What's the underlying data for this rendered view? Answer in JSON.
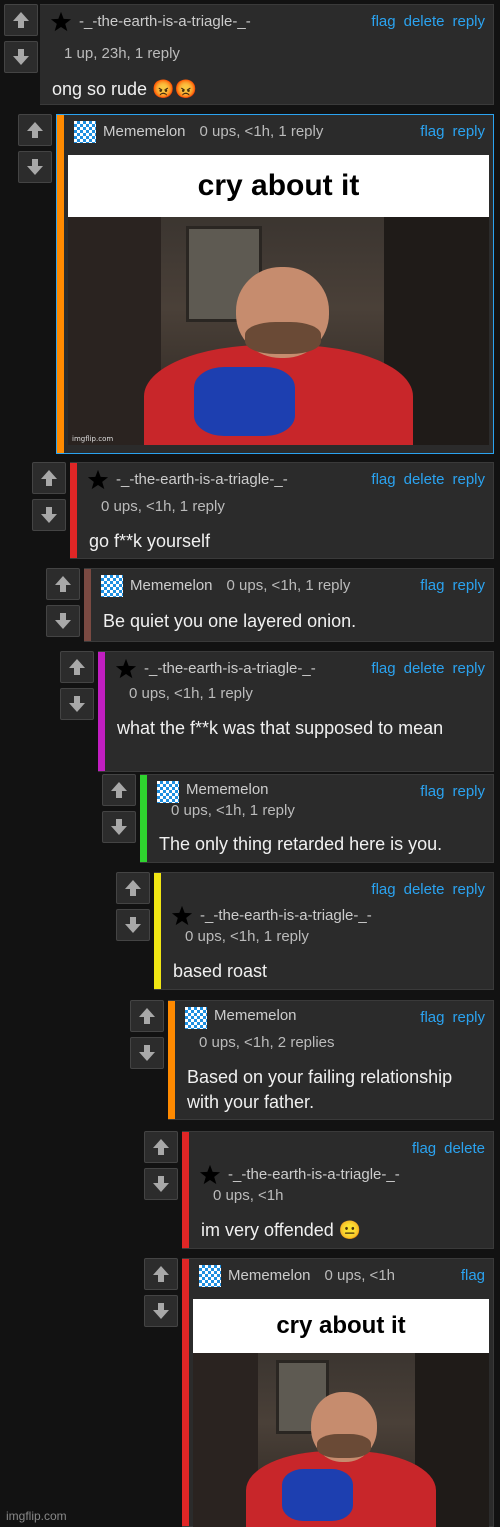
{
  "comments": [
    {
      "user": "-_-the-earth-is-a-triagle-_-",
      "meta": "1 up, 23h, 1 reply",
      "text": "ong so rude 😡😡",
      "actions": [
        "flag",
        "delete",
        "reply"
      ],
      "bar_color": "",
      "avatar": "star-icon"
    },
    {
      "user": "Mememelon",
      "meta": "0 ups, <1h, 1 reply",
      "actions": [
        "flag",
        "reply"
      ],
      "bar_color": "#ff8a00",
      "avatar": "checker-avatar",
      "image_caption": "cry about it",
      "image_watermark": "imgflip.com"
    },
    {
      "user": "-_-the-earth-is-a-triagle-_-",
      "meta": "0 ups, <1h, 1 reply",
      "text": "go f**k yourself",
      "actions": [
        "flag",
        "delete",
        "reply"
      ],
      "bar_color": "#e02626",
      "avatar": "star-icon"
    },
    {
      "user": "Mememelon",
      "meta": "0 ups, <1h, 1 reply",
      "text": "Be quiet you one layered onion.",
      "actions": [
        "flag",
        "reply"
      ],
      "bar_color": "#7a4a42",
      "avatar": "checker-avatar"
    },
    {
      "user": "-_-the-earth-is-a-triagle-_-",
      "meta": "0 ups, <1h, 1 reply",
      "text": "what the f**k was that supposed to mean",
      "actions": [
        "flag",
        "delete",
        "reply"
      ],
      "bar_color": "#c21ec2",
      "avatar": "star-icon"
    },
    {
      "user": "Mememelon",
      "meta": "0 ups, <1h, 1 reply",
      "text": "The only thing retarded here is you.",
      "actions": [
        "flag",
        "reply"
      ],
      "bar_color": "#2fd32f",
      "avatar": "checker-avatar"
    },
    {
      "user": "-_-the-earth-is-a-triagle-_-",
      "meta": "0 ups, <1h, 1 reply",
      "text": "based roast",
      "actions": [
        "flag",
        "delete",
        "reply"
      ],
      "bar_color": "#f0e614",
      "avatar": "star-icon"
    },
    {
      "user": "Mememelon",
      "meta": "0 ups, <1h, 2 replies",
      "text": "Based on your failing relationship with your father.",
      "actions": [
        "flag",
        "reply"
      ],
      "bar_color": "#ff8a00",
      "avatar": "checker-avatar"
    },
    {
      "user": "-_-the-earth-is-a-triagle-_-",
      "meta": "0 ups, <1h",
      "text": "im very offended 😐",
      "actions": [
        "flag",
        "delete"
      ],
      "bar_color": "#e02626",
      "avatar": "star-icon"
    },
    {
      "user": "Mememelon",
      "meta": "0 ups, <1h",
      "actions": [
        "flag"
      ],
      "bar_color": "#e02626",
      "avatar": "checker-avatar",
      "image_caption": "cry about it"
    }
  ],
  "footer_watermark": "imgflip.com"
}
